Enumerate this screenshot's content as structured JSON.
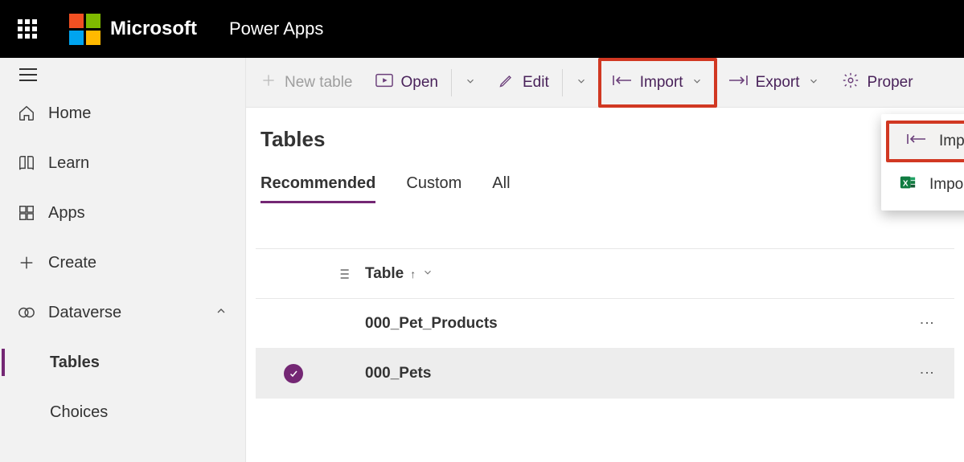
{
  "header": {
    "brand": "Microsoft",
    "app_name": "Power Apps"
  },
  "sidebar": {
    "items": [
      {
        "icon": "home",
        "label": "Home"
      },
      {
        "icon": "learn",
        "label": "Learn"
      },
      {
        "icon": "apps",
        "label": "Apps"
      },
      {
        "icon": "create",
        "label": "Create"
      },
      {
        "icon": "dataverse",
        "label": "Dataverse",
        "expanded": true
      }
    ],
    "sub_items": [
      {
        "label": "Tables",
        "active": true
      },
      {
        "label": "Choices",
        "active": false
      }
    ]
  },
  "commandbar": {
    "new_table": "New table",
    "open": "Open",
    "edit": "Edit",
    "import": "Import",
    "export": "Export",
    "properties": "Proper"
  },
  "import_dropdown": {
    "items": [
      {
        "icon": "import",
        "label": "Import data",
        "highlighted": true
      },
      {
        "icon": "excel",
        "label": "Import data from Excel",
        "highlighted": false
      }
    ]
  },
  "page": {
    "title": "Tables",
    "tabs": [
      {
        "label": "Recommended",
        "active": true
      },
      {
        "label": "Custom",
        "active": false
      },
      {
        "label": "All",
        "active": false
      }
    ],
    "column_header": "Table",
    "rows": [
      {
        "name": "000_Pet_Products",
        "selected": false
      },
      {
        "name": "000_Pets",
        "selected": true
      }
    ]
  }
}
